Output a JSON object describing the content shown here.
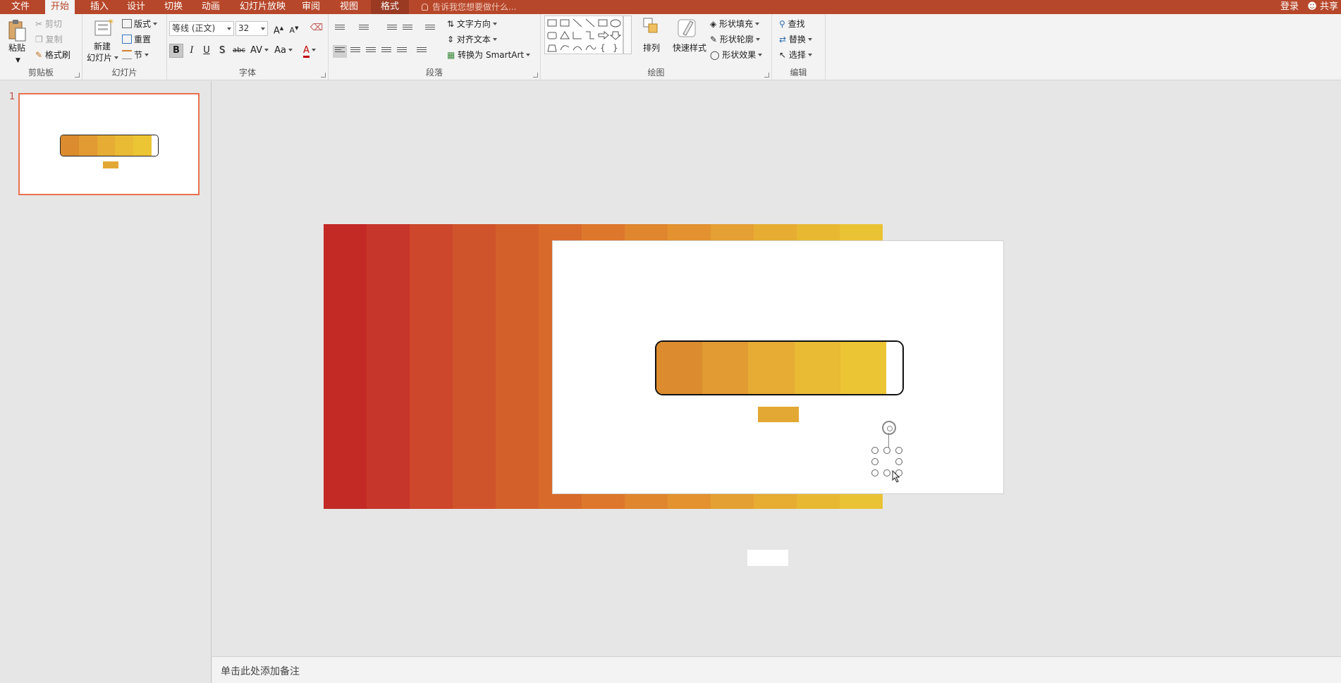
{
  "tabs": [
    {
      "label": "文件",
      "active": false
    },
    {
      "label": "开始",
      "active": true
    },
    {
      "label": "插入",
      "active": false
    },
    {
      "label": "设计",
      "active": false
    },
    {
      "label": "切换",
      "active": false
    },
    {
      "label": "动画",
      "active": false
    },
    {
      "label": "幻灯片放映",
      "active": false
    },
    {
      "label": "审阅",
      "active": false
    },
    {
      "label": "视图",
      "active": false
    },
    {
      "label": "格式",
      "active": false
    }
  ],
  "tell_me": "告诉我您想要做什么...",
  "login": "登录",
  "share": "共享",
  "ribbon": {
    "clipboard": {
      "label": "剪贴板",
      "paste": "粘贴",
      "cut": "剪切",
      "copy": "复制",
      "format_painter": "格式刷"
    },
    "slides": {
      "label": "幻灯片",
      "new_slide_1": "新建",
      "new_slide_2": "幻灯片",
      "layout": "版式",
      "reset": "重置",
      "section": "节"
    },
    "font": {
      "label": "字体",
      "font_name": "等线 (正文)",
      "font_size": "32",
      "grow": "A",
      "shrink": "A",
      "bold": "B",
      "italic": "I",
      "underline": "U",
      "shadow": "S",
      "strike": "abc",
      "spacing": "AV",
      "case": "Aa",
      "color": "A"
    },
    "paragraph": {
      "label": "段落",
      "text_direction": "文字方向",
      "align_text": "对齐文本",
      "smartart": "转换为 SmartArt"
    },
    "drawing": {
      "label": "绘图",
      "arrange": "排列",
      "quick_styles": "快速样式",
      "shape_fill": "形状填充",
      "shape_outline": "形状轮廓",
      "shape_effects": "形状效果"
    },
    "editing": {
      "label": "编辑",
      "find": "查找",
      "replace": "替换",
      "select": "选择"
    }
  },
  "thumbnail": {
    "number": "1"
  },
  "colors": {
    "tab_bar": "#b7472a",
    "thumb_border": "#e9714e",
    "stripes": [
      "#c42a25",
      "#c7362a",
      "#cc472b",
      "#d0542b",
      "#d3602b",
      "#d86a2b",
      "#dd772c",
      "#e0862e",
      "#e3922f",
      "#e4a032",
      "#e6ad32",
      "#e8b833",
      "#eac335"
    ],
    "bar_segments": [
      "#dc8b2e",
      "#e29a32",
      "#e6ac33",
      "#e9ba34",
      "#ecc535",
      "#ffffff"
    ],
    "small_box": "#e3a834"
  },
  "notes_placeholder": "单击此处添加备注"
}
